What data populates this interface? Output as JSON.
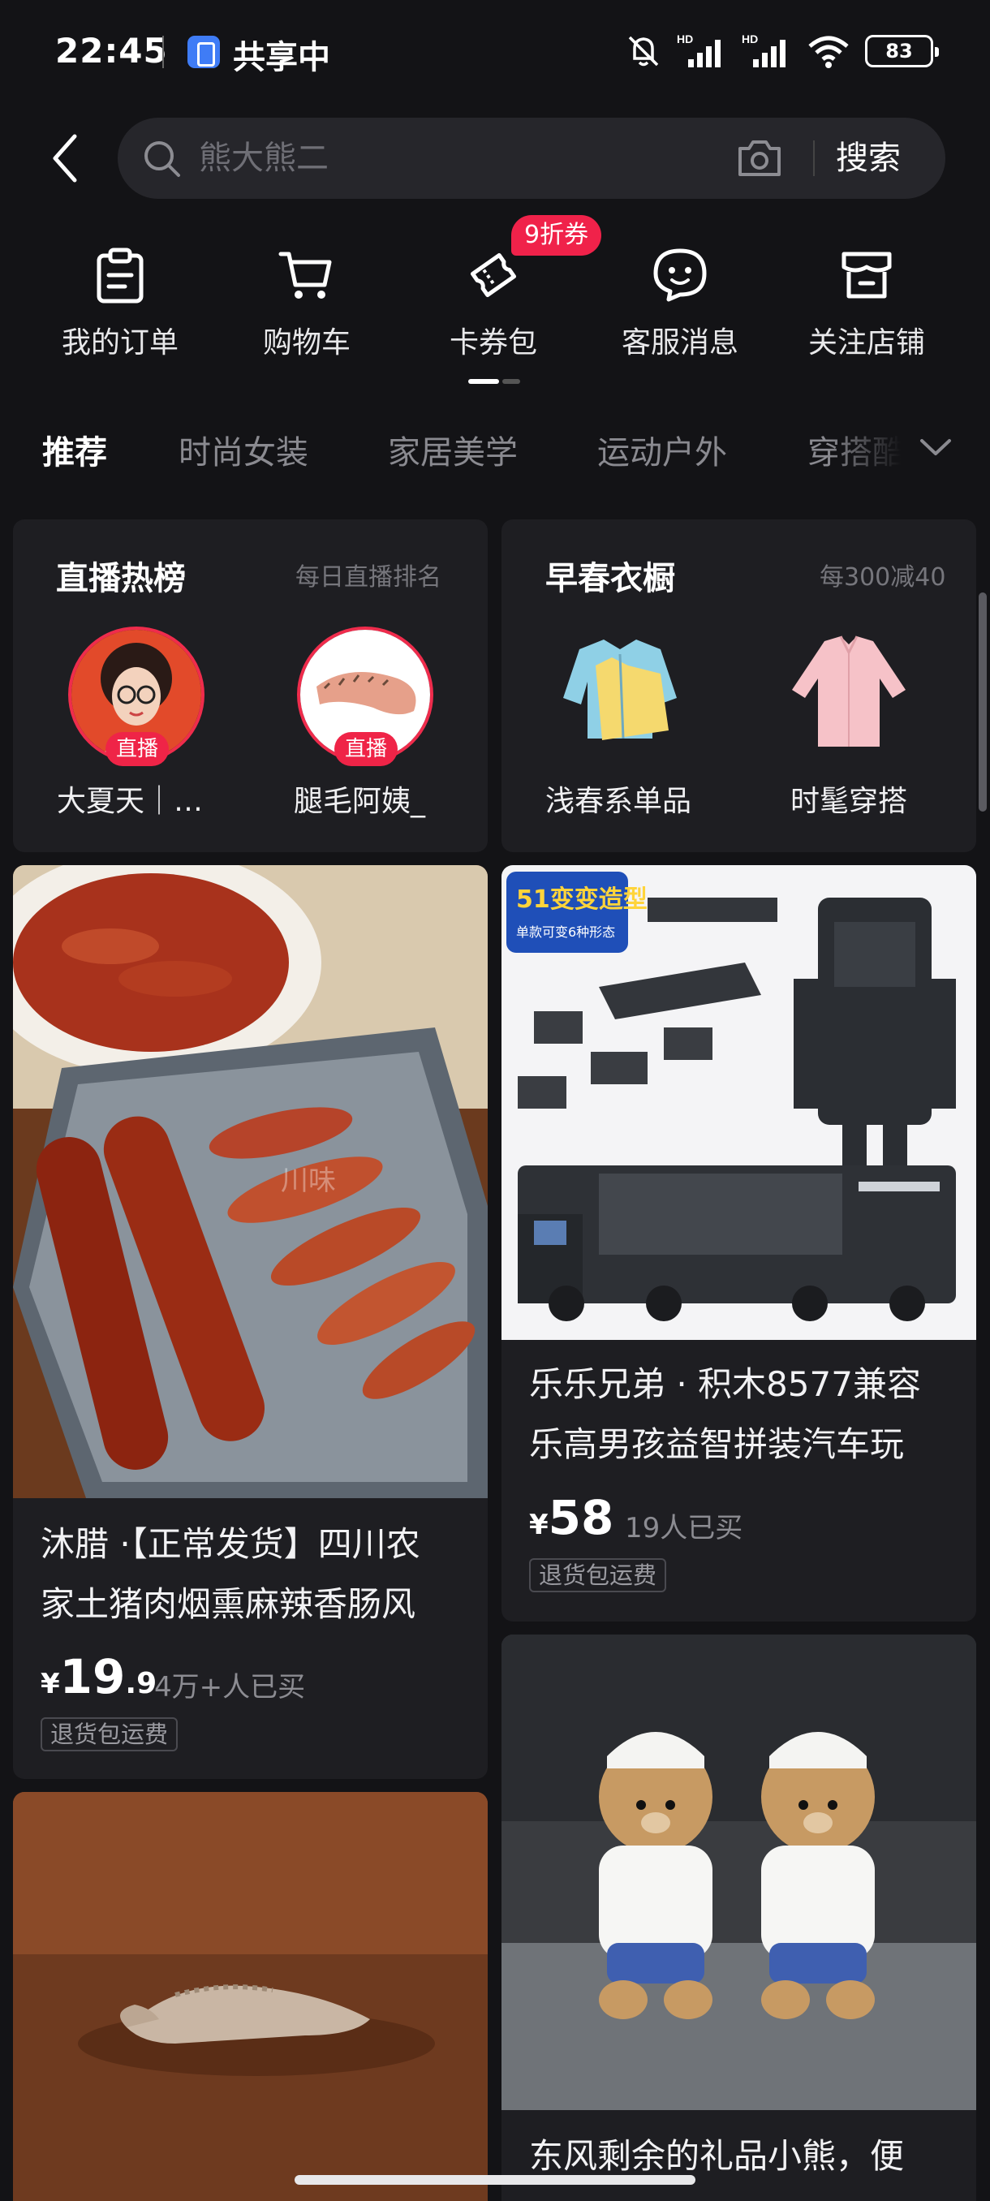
{
  "status_bar": {
    "time": "22:45",
    "share_label": "共享中",
    "battery": "83",
    "signal_label_1": "HD",
    "signal_label_2": "HD"
  },
  "search": {
    "placeholder": "熊大熊二",
    "button_label": "搜索"
  },
  "quick_nav": {
    "items": [
      {
        "label": "我的订单",
        "icon": "clipboard-icon"
      },
      {
        "label": "购物车",
        "icon": "cart-icon"
      },
      {
        "label": "卡券包",
        "icon": "coupon-icon"
      },
      {
        "label": "客服消息",
        "icon": "chat-icon"
      },
      {
        "label": "关注店铺",
        "icon": "store-icon"
      }
    ],
    "coupon_badge": "9折券"
  },
  "categories": {
    "tabs": [
      "推荐",
      "时尚女装",
      "家居美学",
      "运动户外",
      "穿搭酷"
    ],
    "active_index": 0
  },
  "live_card": {
    "title": "直播热榜",
    "subtitle": "每日直播排名",
    "streamers": [
      {
        "name": "大夏天｜…",
        "tag": "直播"
      },
      {
        "name": "腿毛阿姨_",
        "tag": "直播"
      }
    ]
  },
  "spring_card": {
    "title": "早春衣橱",
    "subtitle": "每300减40",
    "items": [
      {
        "label": "浅春系单品"
      },
      {
        "label": "时髦穿搭"
      }
    ]
  },
  "products": [
    {
      "title_line1": "沐腊 ·【正常发货】四川农",
      "title_line2": "家土猪肉烟熏麻辣香肠风",
      "price_symbol": "¥",
      "price_int": "19",
      "price_dec": ".9",
      "sold": "4万+人已买",
      "tag": "退货包运费",
      "watermark": "川味"
    },
    {
      "title_line1": "乐乐兄弟 · 积木8577兼容",
      "title_line2": "乐高男孩益智拼装汽车玩",
      "price_symbol": "¥",
      "price_int": "58",
      "sold": "19人已买",
      "tag": "退货包运费",
      "badge_main": "51变变造型",
      "badge_sub": "单款可变6种形态"
    },
    {
      "title_line1": "东风剩余的礼品小熊，便"
    }
  ],
  "colors": {
    "background": "#131316",
    "card": "#1e1e22",
    "accent_red": "#ef2447"
  }
}
